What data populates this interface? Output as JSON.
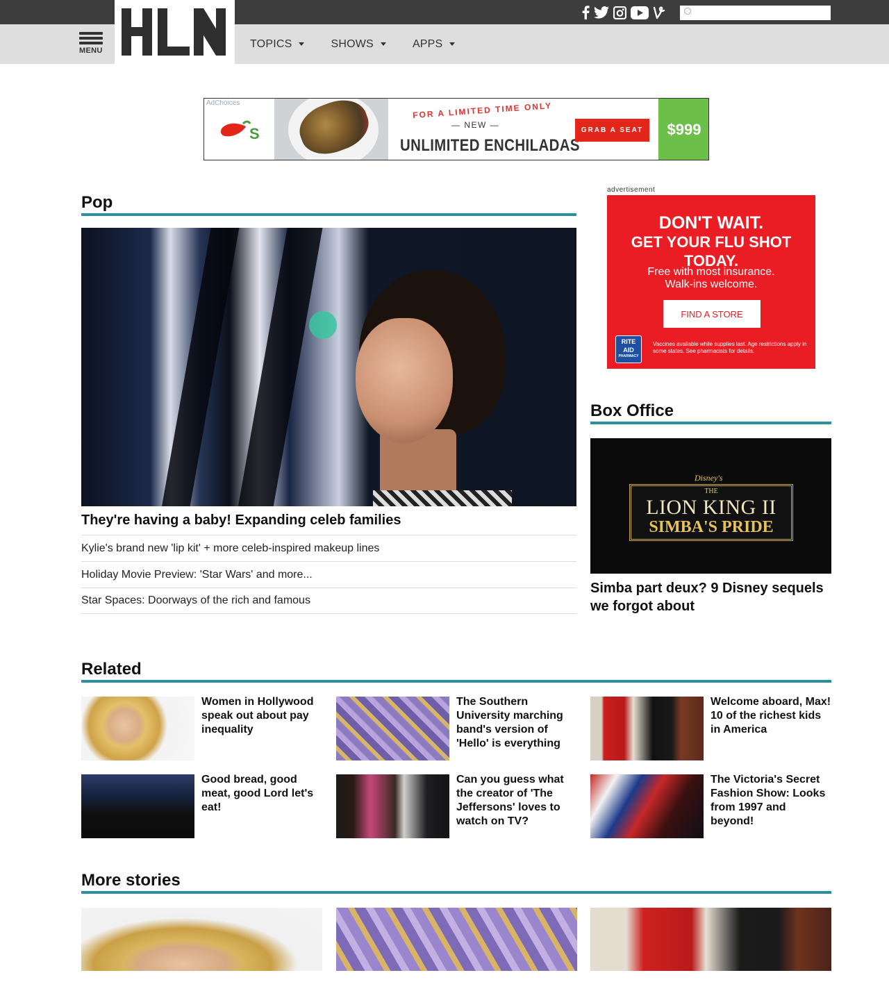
{
  "header": {
    "menu_label": "MENU",
    "logo_text": "HLN",
    "nav": [
      {
        "label": "TOPICS"
      },
      {
        "label": "SHOWS"
      },
      {
        "label": "APPS"
      }
    ],
    "social_icons": [
      "facebook-icon",
      "twitter-icon",
      "instagram-icon",
      "youtube-icon",
      "vine-icon"
    ],
    "search_placeholder": "",
    "colors": {
      "topbar": "#3d3d3d",
      "navbar": "#dedede",
      "accent_rule": "#2a8f9e"
    }
  },
  "top_ad": {
    "adchoices": "AdChoices",
    "limited": "FOR A LIMITED TIME ONLY",
    "new_line": "— NEW —",
    "headline": "UNLIMITED ENCHILADAS",
    "cta": "GRAB A SEAT",
    "price": "$999",
    "colors": {
      "red": "#e2271a",
      "green": "#6cc04a"
    }
  },
  "pop": {
    "title": "Pop",
    "headline": "They're having a baby! Expanding celeb families",
    "links": [
      "Kylie's brand new 'lip kit' + more celeb-inspired makeup lines",
      "Holiday Movie Preview: 'Star Wars' and more...",
      "Star Spaces: Doorways of the rich and famous"
    ]
  },
  "side_ad": {
    "label": "advertisement",
    "line1": "DON'T WAIT.",
    "line2": "GET YOUR FLU SHOT",
    "line3": "TODAY.",
    "line4": "Free with most insurance.",
    "line5": "Walk-ins welcome.",
    "button": "FIND A STORE",
    "logo_top": "RITE",
    "logo_bottom": "AID",
    "logo_sub": "PHARMACY",
    "fine_print": "Vaccines available while supplies last. Age restrictions apply in some states. See pharmacists for details.",
    "color": "#ea1c24"
  },
  "box_office": {
    "title": "Box Office",
    "poster_brand": "Disney's",
    "poster_the": "THE",
    "poster_title": "LION KING II",
    "poster_subtitle": "SIMBA'S PRIDE",
    "headline": "Simba part deux? 9 Disney sequels we forgot about"
  },
  "related": {
    "title": "Related",
    "items": [
      {
        "text": "Women in Hollywood speak out about pay inequality"
      },
      {
        "text": "The Southern University marching band's version of 'Hello' is everything"
      },
      {
        "text": "Welcome aboard, Max! 10 of the richest kids in America"
      },
      {
        "text": "Good bread, good meat, good Lord let's eat!"
      },
      {
        "text": "Can you guess what the creator of 'The Jeffersons' loves to watch on TV?"
      },
      {
        "text": "The Victoria's Secret Fashion Show: Looks from 1997 and beyond!"
      }
    ]
  },
  "more_stories": {
    "title": "More stories"
  }
}
